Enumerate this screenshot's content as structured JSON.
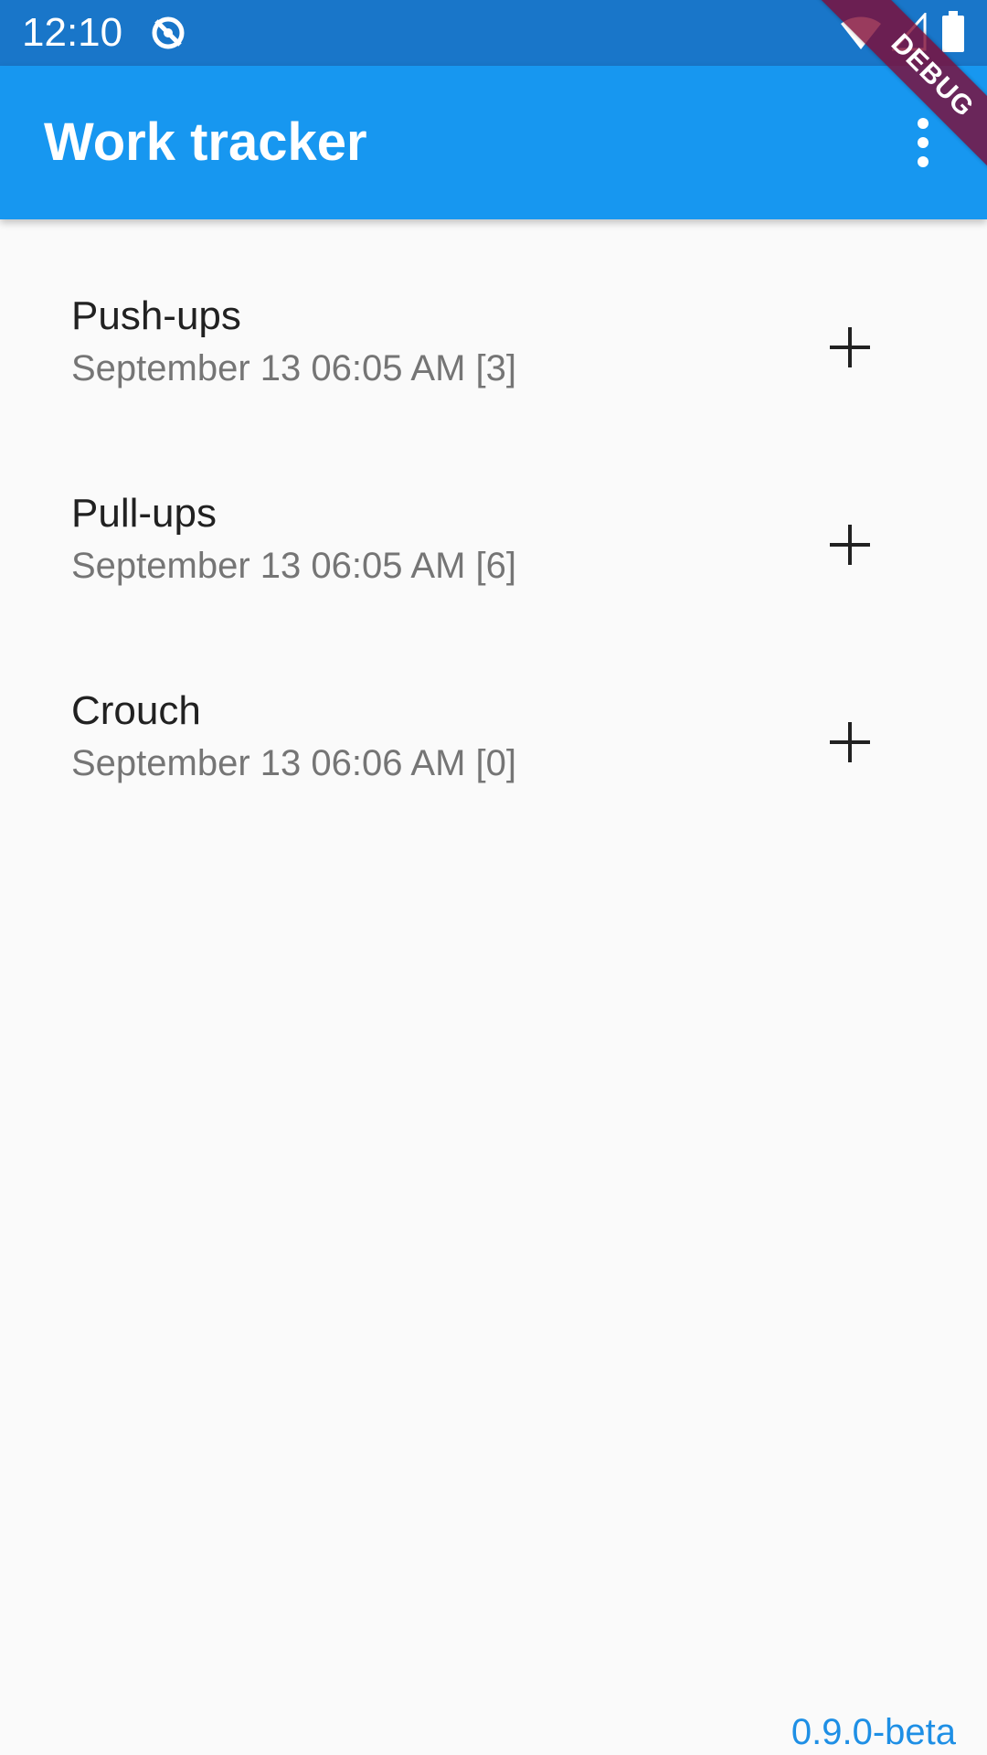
{
  "status_bar": {
    "time": "12:10",
    "icons": [
      "sync-icon",
      "wifi-icon",
      "signal-icon",
      "battery-icon"
    ]
  },
  "app_bar": {
    "title": "Work tracker",
    "menu_icon": "overflow-menu-icon",
    "background_color": "#1797f0"
  },
  "debug_banner": {
    "label": "DEBUG"
  },
  "exercises": [
    {
      "name": "Push-ups",
      "detail": "September 13 06:05 AM [3]",
      "action_icon": "add-icon"
    },
    {
      "name": "Pull-ups",
      "detail": "September 13 06:05 AM [6]",
      "action_icon": "add-icon"
    },
    {
      "name": "Crouch",
      "detail": "September 13 06:06 AM [0]",
      "action_icon": "add-icon"
    }
  ],
  "footer": {
    "version": "0.9.0-beta"
  },
  "colors": {
    "status_bar": "#1976c9",
    "accent": "#1e8fe5",
    "background": "#fafafa"
  }
}
